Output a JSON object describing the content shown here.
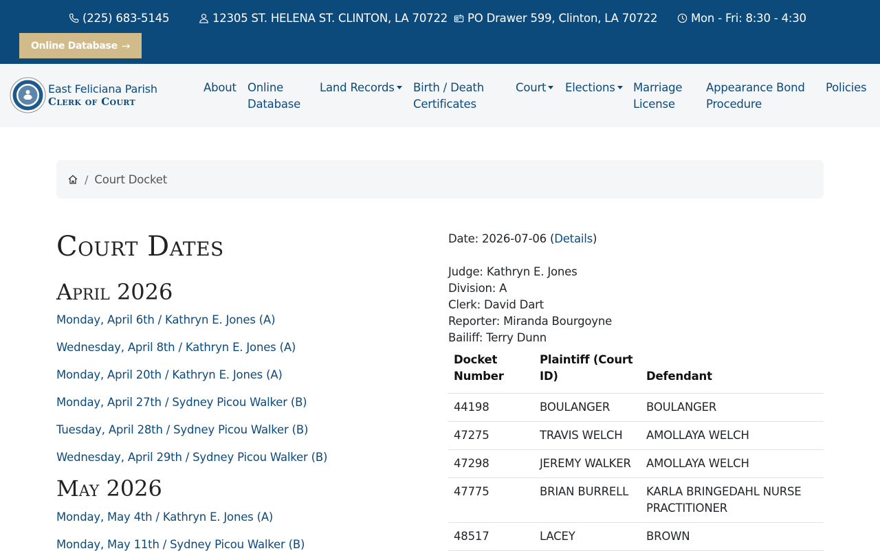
{
  "topbar": {
    "phone": "(225) 683-5145",
    "address": "12305 ST. HELENA ST. CLINTON, LA 70722",
    "po_box": "PO Drawer 599, Clinton, LA 70722",
    "hours": "Mon - Fri: 8:30 - 4:30",
    "online_database_button": "Online Database",
    "online_database_arrow": "→"
  },
  "brand": {
    "line1": "East Feliciana Parish",
    "line2": "Clerk of Court"
  },
  "nav": {
    "about": "About",
    "online_database_1": "Online",
    "online_database_2": "Database",
    "land_records": "Land Records",
    "birth_death_1": "Birth / Death",
    "birth_death_2": "Certificates",
    "court": "Court",
    "elections": "Elections",
    "marriage_1": "Marriage",
    "marriage_2": "License",
    "appearance_1": "Appearance Bond",
    "appearance_2": "Procedure",
    "policies": "Policies"
  },
  "breadcrumb": {
    "separator": "/",
    "current": "Court Docket"
  },
  "court_dates": {
    "title": "Court Dates",
    "months": [
      {
        "name": "April 2026",
        "dates": [
          "Monday, April 6th / Kathryn E. Jones (A)",
          "Wednesday, April 8th / Kathryn E. Jones (A)",
          "Monday, April 20th / Kathryn E. Jones (A)",
          "Monday, April 27th / Sydney Picou Walker (B)",
          "Tuesday, April 28th / Sydney Picou Walker (B)",
          "Wednesday, April 29th / Sydney Picou Walker (B)"
        ]
      },
      {
        "name": "May 2026",
        "dates": [
          "Monday, May 4th / Kathryn E. Jones (A)",
          "Monday, May 11th / Sydney Picou Walker (B)"
        ]
      }
    ]
  },
  "docket": {
    "date_label": "Date: 2026-07-06 (",
    "details_link": "Details",
    "date_close": ")",
    "judge": "Judge: Kathryn E. Jones",
    "division": "Division: A",
    "clerk": "Clerk: David Dart",
    "reporter": "Reporter: Miranda Bourgoyne",
    "bailiff": "Bailiff: Terry Dunn",
    "headers": {
      "docket_number": "Docket Number",
      "plaintiff": "Plaintiff (Court ID)",
      "defendant": "Defendant"
    },
    "rows": [
      {
        "docket": "44198",
        "plaintiff": "BOULANGER",
        "defendant": "BOULANGER"
      },
      {
        "docket": "47275",
        "plaintiff": "TRAVIS WELCH",
        "defendant": "AMOLLAYA WELCH"
      },
      {
        "docket": "47298",
        "plaintiff": "JEREMY WALKER",
        "defendant": "AMOLLAYA WELCH"
      },
      {
        "docket": "47775",
        "plaintiff": "BRIAN BURRELL",
        "defendant": "KARLA BRINGEDAHL NURSE PRACTITIONER"
      },
      {
        "docket": "48517",
        "plaintiff": "LACEY",
        "defendant": "BROWN"
      }
    ]
  },
  "colors": {
    "topbar_bg": "#0d4a7c",
    "accent_gold": "#d2bb8a",
    "link": "#0d4a7c",
    "nav_bg": "#f5f6f8"
  }
}
